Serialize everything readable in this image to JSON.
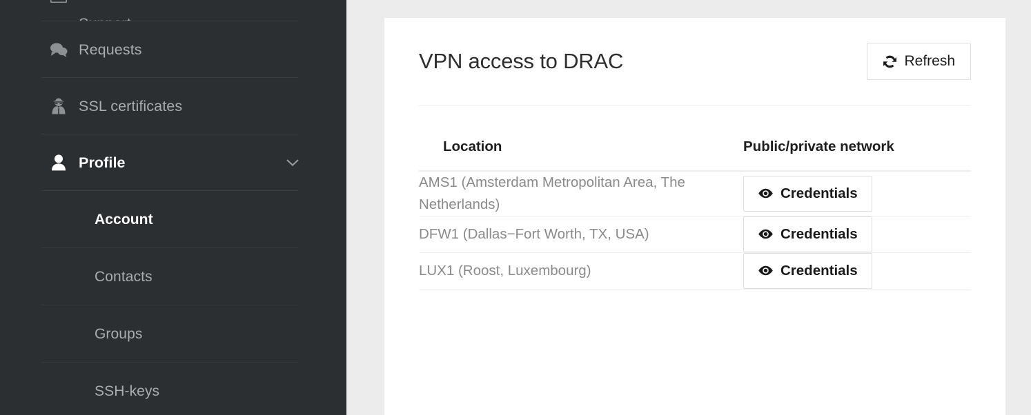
{
  "sidebar": {
    "items": [
      {
        "label": "Support",
        "icon": "envelope-icon",
        "active": false,
        "clipped": true
      },
      {
        "label": "Requests",
        "icon": "comments-icon",
        "active": false,
        "clipped": false
      },
      {
        "label": "SSL certificates",
        "icon": "user-secret-icon",
        "active": false,
        "clipped": false
      },
      {
        "label": "Profile",
        "icon": "user-icon",
        "active": true,
        "clipped": false,
        "expanded": true,
        "chevron": "chevron-down-icon"
      }
    ],
    "sub_items": [
      {
        "label": "Account",
        "active": true
      },
      {
        "label": "Contacts",
        "active": false
      },
      {
        "label": "Groups",
        "active": false
      },
      {
        "label": "SSH-keys",
        "active": false
      }
    ]
  },
  "main": {
    "title": "VPN access to DRAC",
    "refresh_label": "Refresh",
    "refresh_icon": "sync-icon",
    "table": {
      "columns": [
        "Location",
        "Public/private network"
      ],
      "rows": [
        {
          "location": "AMS1 (Amsterdam Metropolitan Area, The Netherlands)",
          "action_label": "Credentials",
          "action_icon": "eye-icon"
        },
        {
          "location": "DFW1 (Dallas−Fort Worth, TX, USA)",
          "action_label": "Credentials",
          "action_icon": "eye-icon"
        },
        {
          "location": "LUX1 (Roost, Luxembourg)",
          "action_label": "Credentials",
          "action_icon": "eye-icon"
        }
      ]
    }
  },
  "colors": {
    "sidebar_bg": "#2b2f31",
    "page_bg": "#ececec",
    "card_bg": "#ffffff",
    "muted_text": "#8a8a8a",
    "nav_text": "#a9adb0"
  }
}
